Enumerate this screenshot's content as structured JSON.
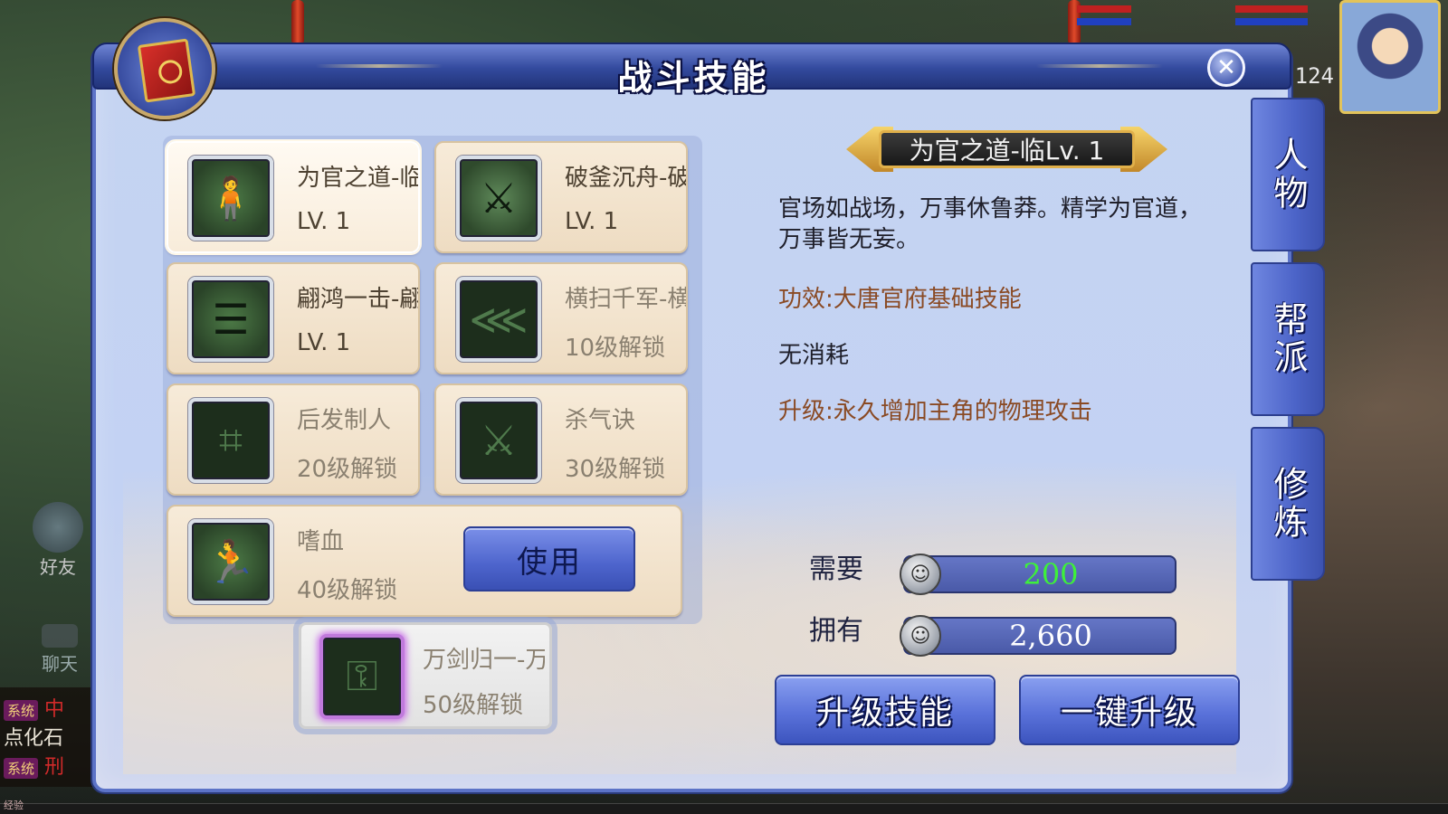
{
  "background": {
    "friends_label": "好友",
    "chat_label": "聊天",
    "log": [
      {
        "tag": "系统",
        "text": "中"
      },
      {
        "tag": "",
        "text": "点化石"
      },
      {
        "tag": "系统",
        "text": "刑"
      }
    ],
    "level": "124",
    "exp_label": "经验"
  },
  "window": {
    "title": "战斗技能",
    "close_icon": "close-icon"
  },
  "skills": [
    {
      "name": "为官之道-临",
      "sub": "LV. 1",
      "locked": false,
      "icon": "figure-icon",
      "glyph": "🧍"
    },
    {
      "name": "破釜沉舟-破",
      "sub": "LV. 1",
      "locked": false,
      "icon": "crossed-blades-icon",
      "glyph": "⚔"
    },
    {
      "name": "翩鸿一击-翩",
      "sub": "LV. 1",
      "locked": false,
      "icon": "scroll-icon",
      "glyph": "☰"
    },
    {
      "name": "横扫千军-横",
      "sub": "10级解锁",
      "locked": true,
      "icon": "chevrons-icon",
      "glyph": "⋘"
    },
    {
      "name": "后发制人",
      "sub": "20级解锁",
      "locked": true,
      "icon": "maze-icon",
      "glyph": "⌗"
    },
    {
      "name": "杀气诀",
      "sub": "30级解锁",
      "locked": true,
      "icon": "sword-slash-icon",
      "glyph": "⚔"
    },
    {
      "name": "嗜血",
      "sub": "40级解锁",
      "locked": true,
      "icon": "running-strike-icon",
      "glyph": "🏃"
    },
    {
      "name": "万剑归一-万",
      "sub": "50级解锁",
      "locked": true,
      "icon": "key-icon",
      "glyph": "⚿"
    }
  ],
  "use_button": "使用",
  "detail": {
    "title": "为官之道-临Lv. 1",
    "description": "官场如战场，万事休鲁莽。精学为官道，万事皆无妄。",
    "effect_label": "功效:",
    "effect_value": "大唐官府基础技能",
    "cost": "无消耗",
    "upgrade_label": "升级:",
    "upgrade_value": "永久增加主角的物理攻击"
  },
  "resources": {
    "need_label": "需要",
    "need_value": "200",
    "have_label": "拥有",
    "have_value": "2,660",
    "coin_icon": "silver-coin-icon"
  },
  "buttons": {
    "upgrade": "升级技能",
    "one_click": "一键升级"
  },
  "side_tabs": [
    "人物",
    "帮派",
    "修炼"
  ],
  "colors": {
    "panel": "#c5d4f2",
    "accent": "#4d64cc",
    "need_value": "#3ef03a",
    "effect_text": "#8a4a24"
  }
}
